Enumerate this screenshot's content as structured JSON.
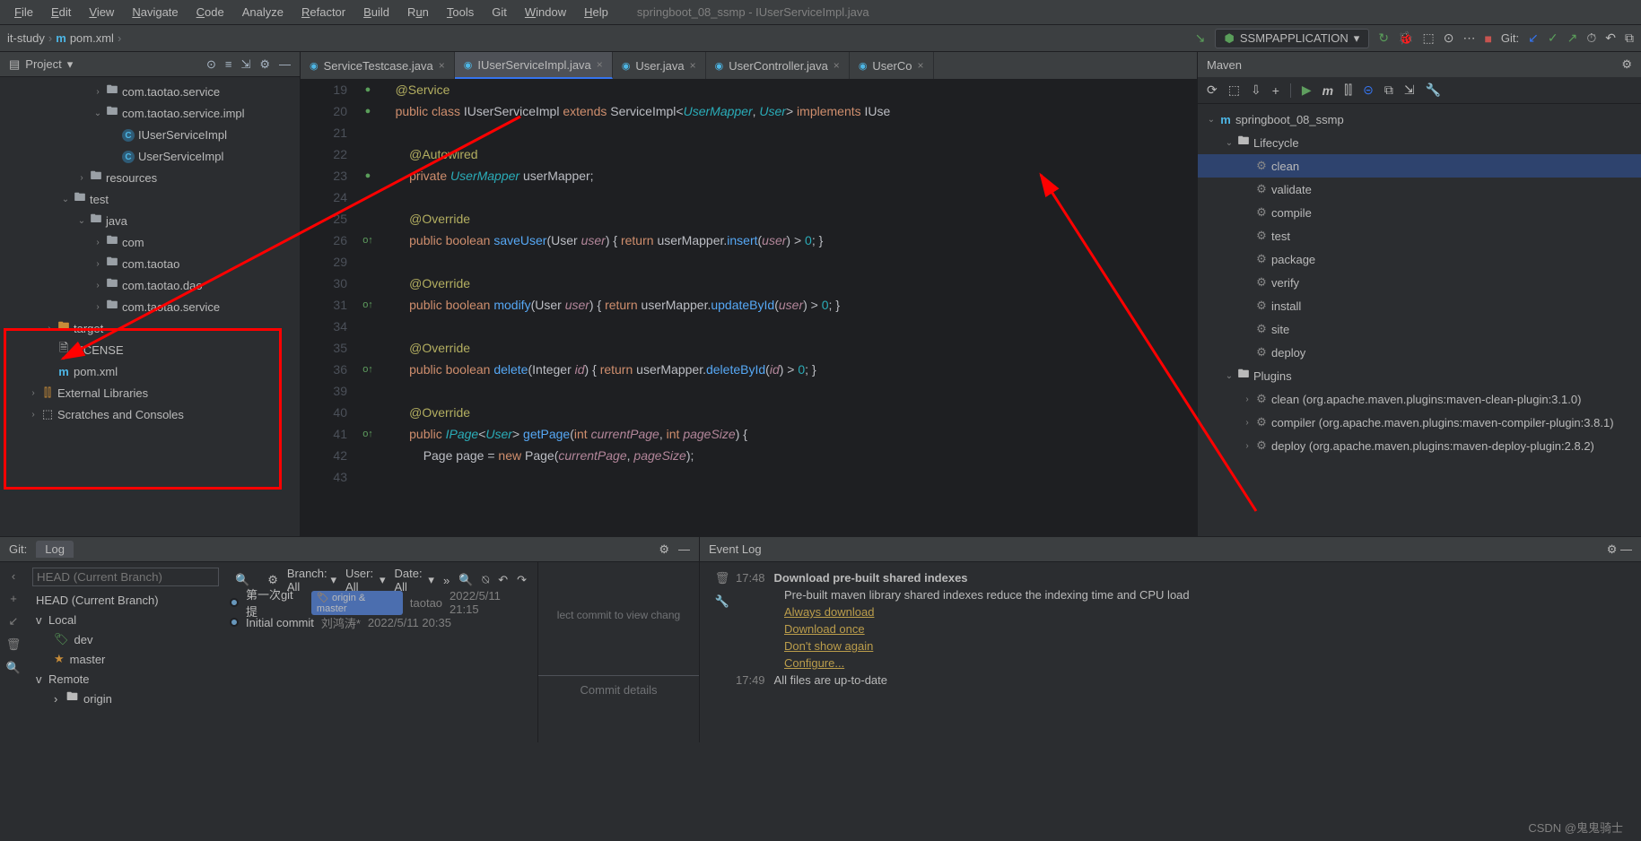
{
  "window": {
    "title": "springboot_08_ssmp - IUserServiceImpl.java"
  },
  "menu": {
    "file": "File",
    "edit": "Edit",
    "view": "View",
    "navigate": "Navigate",
    "code": "Code",
    "analyze": "Analyze",
    "refactor": "Refactor",
    "build": "Build",
    "run": "Run",
    "tools": "Tools",
    "git": "Git",
    "window": "Window",
    "help": "Help"
  },
  "breadcrumb": {
    "root": "it-study",
    "file": "pom.xml"
  },
  "run_config": {
    "name": "SSMPAPPLICATION",
    "git_label": "Git:"
  },
  "project": {
    "title": "Project",
    "tree": [
      {
        "depth": 3,
        "arrow": ">",
        "icon": "folder",
        "label": "com.taotao.service"
      },
      {
        "depth": 3,
        "arrow": "v",
        "icon": "folder",
        "label": "com.taotao.service.impl"
      },
      {
        "depth": 4,
        "arrow": "",
        "icon": "class",
        "label": "IUserServiceImpl"
      },
      {
        "depth": 4,
        "arrow": "",
        "icon": "class",
        "label": "UserServiceImpl"
      },
      {
        "depth": 2,
        "arrow": ">",
        "icon": "folder",
        "label": "resources"
      },
      {
        "depth": 1,
        "arrow": "v",
        "icon": "folder",
        "label": "test"
      },
      {
        "depth": 2,
        "arrow": "v",
        "icon": "folder",
        "label": "java"
      },
      {
        "depth": 3,
        "arrow": ">",
        "icon": "folder",
        "label": "com"
      },
      {
        "depth": 3,
        "arrow": ">",
        "icon": "folder",
        "label": "com.taotao"
      },
      {
        "depth": 3,
        "arrow": ">",
        "icon": "folder",
        "label": "com.taotao.dao"
      },
      {
        "depth": 3,
        "arrow": ">",
        "icon": "folder",
        "label": "com.taotao.service"
      },
      {
        "depth": 0,
        "arrow": ">",
        "icon": "folder-orange",
        "label": "target"
      },
      {
        "depth": 0,
        "arrow": "",
        "icon": "file",
        "label": "LICENSE"
      },
      {
        "depth": 0,
        "arrow": "",
        "icon": "maven",
        "label": "pom.xml"
      },
      {
        "depth": -1,
        "arrow": ">",
        "icon": "lib",
        "label": "External Libraries"
      },
      {
        "depth": -1,
        "arrow": ">",
        "icon": "scratch",
        "label": "Scratches and Consoles"
      }
    ]
  },
  "editor": {
    "tabs": [
      {
        "label": "ServiceTestcase.java",
        "active": false
      },
      {
        "label": "IUserServiceImpl.java",
        "active": true
      },
      {
        "label": "User.java",
        "active": false
      },
      {
        "label": "UserController.java",
        "active": false
      },
      {
        "label": "UserCo",
        "active": false
      }
    ],
    "lines": [
      {
        "n": 19,
        "g": "●",
        "html": "<span class='annotation'>@Service</span>"
      },
      {
        "n": 20,
        "g": "●",
        "html": "<span class='kw'>public</span> <span class='kw'>class</span> <span class='classname'>IUserServiceImpl</span> <span class='kw'>extends</span> <span class='classname'>ServiceImpl</span><span class='op'>&lt;</span><span class='generic'>UserMapper</span><span class='op'>,</span> <span class='generic'>User</span><span class='op'>&gt;</span> <span class='kw'>implements</span> <span class='classname'>IUse</span>"
      },
      {
        "n": 21,
        "g": "",
        "html": ""
      },
      {
        "n": 22,
        "g": "",
        "html": "    <span class='annotation'>@Autowired</span>"
      },
      {
        "n": 23,
        "g": "●",
        "html": "    <span class='kw'>private</span> <span class='generic'>UserMapper</span> <span class='ident'>userMapper</span><span class='op'>;</span>"
      },
      {
        "n": 24,
        "g": "",
        "html": ""
      },
      {
        "n": 25,
        "g": "",
        "html": "    <span class='annotation'>@Override</span>"
      },
      {
        "n": 26,
        "g": "o↑",
        "html": "    <span class='kw'>public</span> <span class='kw'>boolean</span> <span class='method'>saveUser</span><span class='op'>(</span><span class='classname'>User</span> <span class='param'>user</span><span class='op'>)</span> <span class='op'>{</span> <span class='kw'>return</span> <span class='ident'>userMapper</span><span class='op'>.</span><span class='method'>insert</span><span class='op'>(</span><span class='param'>user</span><span class='op'>)</span> <span class='op'>&gt;</span> <span class='num'>0</span><span class='op'>;</span> <span class='op'>}</span>"
      },
      {
        "n": 29,
        "g": "",
        "html": ""
      },
      {
        "n": 30,
        "g": "",
        "html": "    <span class='annotation'>@Override</span>"
      },
      {
        "n": 31,
        "g": "o↑",
        "html": "    <span class='kw'>public</span> <span class='kw'>boolean</span> <span class='method'>modify</span><span class='op'>(</span><span class='classname'>User</span> <span class='param'>user</span><span class='op'>)</span> <span class='op'>{</span> <span class='kw'>return</span> <span class='ident'>userMapper</span><span class='op'>.</span><span class='method'>updateById</span><span class='op'>(</span><span class='param'>user</span><span class='op'>)</span> <span class='op'>&gt;</span> <span class='num'>0</span><span class='op'>;</span> <span class='op'>}</span>"
      },
      {
        "n": 34,
        "g": "",
        "html": ""
      },
      {
        "n": 35,
        "g": "",
        "html": "    <span class='annotation'>@Override</span>"
      },
      {
        "n": 36,
        "g": "o↑",
        "html": "    <span class='kw'>public</span> <span class='kw'>boolean</span> <span class='method'>delete</span><span class='op'>(</span><span class='classname'>Integer</span> <span class='param'>id</span><span class='op'>)</span> <span class='op'>{</span> <span class='kw'>return</span> <span class='ident'>userMapper</span><span class='op'>.</span><span class='method'>deleteById</span><span class='op'>(</span><span class='param'>id</span><span class='op'>)</span> <span class='op'>&gt;</span> <span class='num'>0</span><span class='op'>;</span> <span class='op'>}</span>"
      },
      {
        "n": 39,
        "g": "",
        "html": ""
      },
      {
        "n": 40,
        "g": "",
        "html": "    <span class='annotation'>@Override</span>"
      },
      {
        "n": 41,
        "g": "o↑",
        "html": "    <span class='kw'>public</span> <span class='generic'>IPage</span><span class='op'>&lt;</span><span class='generic'>User</span><span class='op'>&gt;</span> <span class='method'>getPage</span><span class='op'>(</span><span class='kw'>int</span> <span class='param'>currentPage</span><span class='op'>,</span> <span class='kw'>int</span> <span class='param'>pageSize</span><span class='op'>)</span> <span class='op'>{</span>"
      },
      {
        "n": 42,
        "g": "",
        "html": "        <span class='classname'>Page</span> <span class='ident'>page</span> <span class='op'>=</span> <span class='kw'>new</span> <span class='classname'>Page</span><span class='op'>(</span><span class='param'>currentPage</span><span class='op'>,</span> <span class='param'>pageSize</span><span class='op'>)</span><span class='op'>;</span>"
      },
      {
        "n": 43,
        "g": "",
        "html": ""
      }
    ]
  },
  "maven": {
    "title": "Maven",
    "project": "springboot_08_ssmp",
    "lifecycle_label": "Lifecycle",
    "phases": [
      "clean",
      "validate",
      "compile",
      "test",
      "package",
      "verify",
      "install",
      "site",
      "deploy"
    ],
    "plugins_label": "Plugins",
    "plugins": [
      "clean (org.apache.maven.plugins:maven-clean-plugin:3.1.0)",
      "compiler (org.apache.maven.plugins:maven-compiler-plugin:3.8.1)",
      "deploy (org.apache.maven.plugins:maven-deploy-plugin:2.8.2)"
    ]
  },
  "git": {
    "tab_label": "Log",
    "filters": {
      "branch": "Branch: All",
      "user": "User: All",
      "date": "Date: All"
    },
    "head": "HEAD (Current Branch)",
    "local_label": "Local",
    "local": [
      "dev",
      "master"
    ],
    "remote_label": "Remote",
    "remote": [
      "origin"
    ],
    "commits": [
      {
        "msg": "第一次git提",
        "tags": "origin & master",
        "author": "taotao",
        "date": "2022/5/11 21:15"
      },
      {
        "msg": "Initial commit",
        "tags": "",
        "author": "刘鸿涛*",
        "date": "2022/5/11 20:35"
      }
    ],
    "detail_hint": "lect commit to view chang",
    "commit_details": "Commit details"
  },
  "event": {
    "title": "Event Log",
    "rows": [
      {
        "time": "17:48",
        "bold": "Download pre-built shared indexes"
      },
      {
        "time": "",
        "text": "Pre-built maven library shared indexes reduce the indexing time and CPU load"
      },
      {
        "time": "",
        "link": "Always download"
      },
      {
        "time": "",
        "link": "Download once"
      },
      {
        "time": "",
        "link": "Don't show again"
      },
      {
        "time": "",
        "link": "Configure..."
      },
      {
        "time": "17:49",
        "text": "All files are up-to-date"
      }
    ]
  },
  "watermark": "CSDN @鬼鬼骑士"
}
